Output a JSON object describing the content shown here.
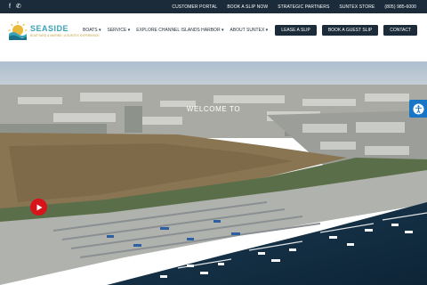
{
  "topbar": {
    "social_icons": [
      "facebook-icon",
      "phone-icon"
    ],
    "links": [
      "CUSTOMER PORTAL",
      "BOOK A SLIP NOW",
      "STRATEGIC PARTNERS",
      "SUNTEX STORE",
      "(805) 985-6000"
    ]
  },
  "logo": {
    "name": "SEASIDE",
    "tagline": "BOATYARD & MARINE / A SUNTEX EXPERIENCE"
  },
  "menu": [
    {
      "label": "BOATS",
      "caret": "▾"
    },
    {
      "label": "SERVICE",
      "caret": "▾"
    },
    {
      "label": "EXPLORE CHANNEL ISLANDS HARBOR",
      "caret": "▾"
    },
    {
      "label": "ABOUT SUNTEX",
      "caret": "▾"
    }
  ],
  "buttons": [
    "LEASE A SLIP",
    "BOOK A GUEST SLIP",
    "CONTACT"
  ],
  "hero": {
    "heading": "WELCOME TO",
    "play_icon": "play-icon",
    "accessibility_icon": "accessibility-icon"
  },
  "colors": {
    "navy": "#1c2b3a",
    "teal": "#3aa3b7",
    "gold": "#c8a13d",
    "play_red": "#d8131a",
    "accessibility_blue": "#1976c7"
  }
}
